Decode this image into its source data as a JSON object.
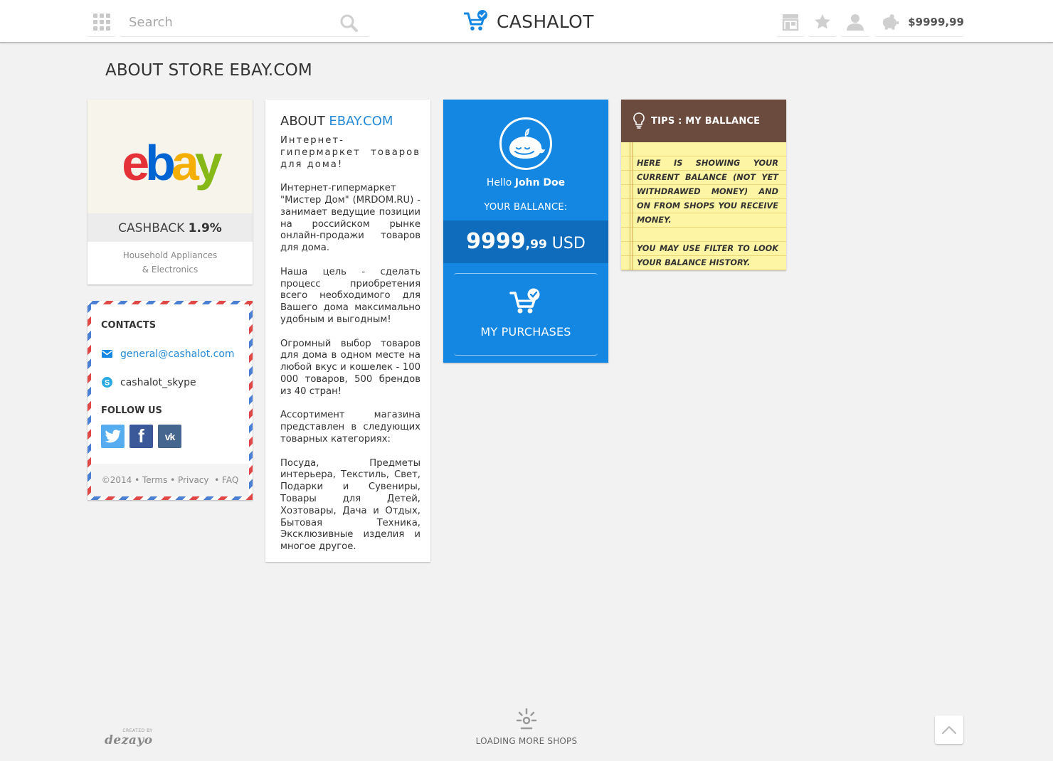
{
  "header": {
    "search_placeholder": "Search",
    "brand": "CASHALOT",
    "balance": "$9999,99"
  },
  "page": {
    "title": "ABOUT STORE EBAY.COM"
  },
  "store": {
    "logo_text": "ebay",
    "cashback_label": "CASHBACK",
    "cashback_value": "1.9%",
    "category_line1": "Household Appliances",
    "category_line2": "& Electronics"
  },
  "contacts": {
    "heading": "CONTACTS",
    "email": "general@cashalot.com",
    "skype": "cashalot_skype",
    "follow_heading": "FOLLOW US",
    "footer": {
      "copyright": "©2014",
      "terms": "Terms",
      "privacy": "Privacy",
      "faq": "FAQ"
    }
  },
  "about": {
    "title_prefix": "ABOUT",
    "title_store": "EBAY.COM",
    "paragraphs": [
      "Интернет-гипермаркет товаров для дома!",
      "Интернет-гипермаркет \"Мистер Дом\" (MRDOM.RU) - занимает ведущие позиции на российском рынке онлайн-продажи товаров для дома.",
      "Наша цель - сделать процесс приобретения всего необходимого для Вашего дома максимально удобным и выгодным!",
      "Огромный выбор товаров для дома в одном месте на любой вкус и кошелек - 100 000 товаров, 500 брендов из 40 стран!",
      "Ассортимент магазина представлен в следующих товарных категориях:",
      "Посуда, Предметы интерьера, Текстиль, Свет, Подарки и Сувениры, Товары для Детей, Хозтовары, Дача и Отдых, Бытовая Техника, Эксклюзивные изделия и многое другое."
    ]
  },
  "balance_card": {
    "hello": "Hello",
    "user_name": "John Doe",
    "your_balance_label": "YOUR BALLANCE:",
    "amount_int": "9999",
    "amount_cents": ",99",
    "currency": "USD",
    "purchases_label": "MY PURCHASES"
  },
  "tips": {
    "title": "TIPS : MY BALLANCE",
    "text1": "HERE IS SHOWING YOUR CURRENT BALANCE (NOT YET WITHDRAWED MONEY) AND ON FROM SHOPS YOU RECEIVE MONEY.",
    "text2": "YOU MAY USE FILTER TO LOOK YOUR BALANCE HISTORY."
  },
  "footer": {
    "credit_small": "CREATED BY",
    "credit": "dezayo",
    "loading": "LOADING MORE SHOPS"
  },
  "colors": {
    "accent": "#2389d6",
    "balance_bg": "#1487e3",
    "balance_dark": "#0f6cbd",
    "tips_head": "#6b4b3e",
    "tips_paper": "#fdf5a4",
    "twitter": "#55acee",
    "facebook": "#3b5998",
    "vk": "#45668e"
  },
  "icons": {
    "grid": "grid-icon",
    "search": "search-icon",
    "logo": "cart-check-icon",
    "shop": "shop-icon",
    "favorites": "star-icon",
    "user": "user-icon",
    "balance": "piggy-bank-icon",
    "email": "envelope-icon",
    "skype": "skype-icon",
    "twitter": "twitter-icon",
    "facebook": "facebook-icon",
    "vk": "vk-icon",
    "whale": "whale-icon",
    "purchases": "cart-check-icon",
    "tips": "lightbulb-icon",
    "loading": "spinner-icon",
    "to_top": "chevron-up-icon"
  }
}
